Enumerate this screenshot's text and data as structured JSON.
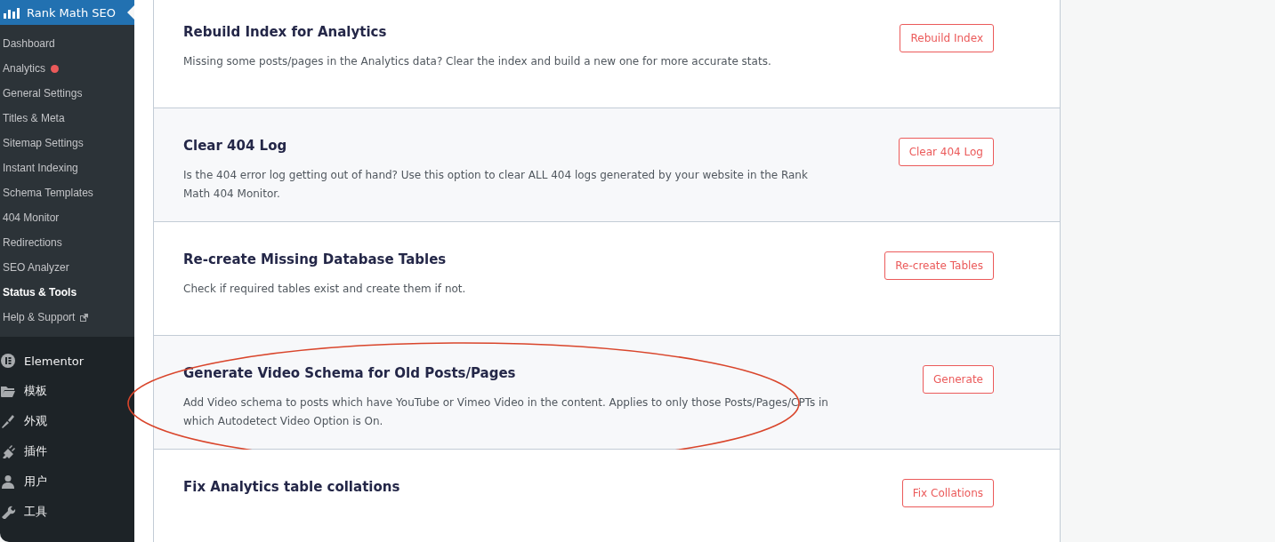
{
  "sidebar": {
    "header": {
      "label": "Rank Math SEO"
    },
    "submenu": [
      {
        "label": "Dashboard",
        "selected": false,
        "badge": false,
        "external": false
      },
      {
        "label": "Analytics",
        "selected": false,
        "badge": true,
        "external": false
      },
      {
        "label": "General Settings",
        "selected": false,
        "badge": false,
        "external": false
      },
      {
        "label": "Titles & Meta",
        "selected": false,
        "badge": false,
        "external": false
      },
      {
        "label": "Sitemap Settings",
        "selected": false,
        "badge": false,
        "external": false
      },
      {
        "label": "Instant Indexing",
        "selected": false,
        "badge": false,
        "external": false
      },
      {
        "label": "Schema Templates",
        "selected": false,
        "badge": false,
        "external": false
      },
      {
        "label": "404 Monitor",
        "selected": false,
        "badge": false,
        "external": false
      },
      {
        "label": "Redirections",
        "selected": false,
        "badge": false,
        "external": false
      },
      {
        "label": "SEO Analyzer",
        "selected": false,
        "badge": false,
        "external": false
      },
      {
        "label": "Status & Tools",
        "selected": true,
        "badge": false,
        "external": false
      },
      {
        "label": "Help & Support",
        "selected": false,
        "badge": false,
        "external": true
      }
    ],
    "menu": [
      {
        "label": "Elementor",
        "kind": "elementor"
      },
      {
        "label": "模板",
        "kind": "folder"
      },
      {
        "label": "外观",
        "kind": "brush"
      },
      {
        "label": "插件",
        "kind": "plug"
      },
      {
        "label": "用户",
        "kind": "user"
      },
      {
        "label": "工具",
        "kind": "wrench"
      }
    ]
  },
  "tools": [
    {
      "title": "Rebuild Index for Analytics",
      "description": "Missing some posts/pages in the Analytics data? Clear the index and build a new one for more accurate stats.",
      "button": "Rebuild Index",
      "circled": false
    },
    {
      "title": "Clear 404 Log",
      "description": "Is the 404 error log getting out of hand? Use this option to clear ALL 404 logs generated by your website in the Rank Math 404 Monitor.",
      "button": "Clear 404 Log",
      "circled": false
    },
    {
      "title": "Re-create Missing Database Tables",
      "description": "Check if required tables exist and create them if not.",
      "button": "Re-create Tables",
      "circled": false
    },
    {
      "title": "Generate Video Schema for Old Posts/Pages",
      "description": "Add Video schema to posts which have YouTube or Vimeo Video in the content. Applies to only those Posts/Pages/CPTs in which Autodetect Video Option is On.",
      "button": "Generate",
      "circled": true
    },
    {
      "title": "Fix Analytics table collations",
      "button": "Fix Collations",
      "circled": false
    }
  ]
}
